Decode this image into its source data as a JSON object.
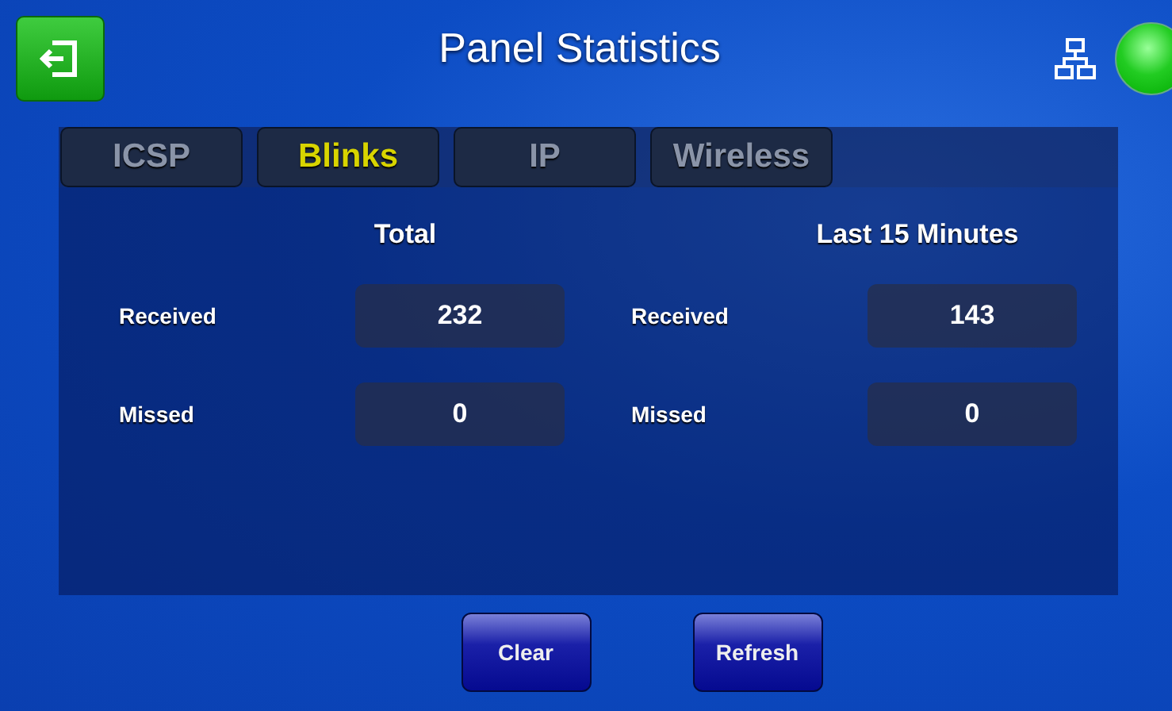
{
  "header": {
    "title": "Panel Statistics"
  },
  "tabs": [
    {
      "label": "ICSP",
      "selected": false
    },
    {
      "label": "Blinks",
      "selected": true
    },
    {
      "label": "IP",
      "selected": false
    },
    {
      "label": "Wireless",
      "selected": false
    }
  ],
  "groups": [
    {
      "heading": "Total",
      "rows": [
        {
          "label": "Received",
          "value": "232"
        },
        {
          "label": "Missed",
          "value": "0"
        }
      ]
    },
    {
      "heading": "Last 15 Minutes",
      "rows": [
        {
          "label": "Received",
          "value": "143"
        },
        {
          "label": "Missed",
          "value": "0"
        }
      ]
    }
  ],
  "buttons": [
    "Clear",
    "Refresh"
  ]
}
